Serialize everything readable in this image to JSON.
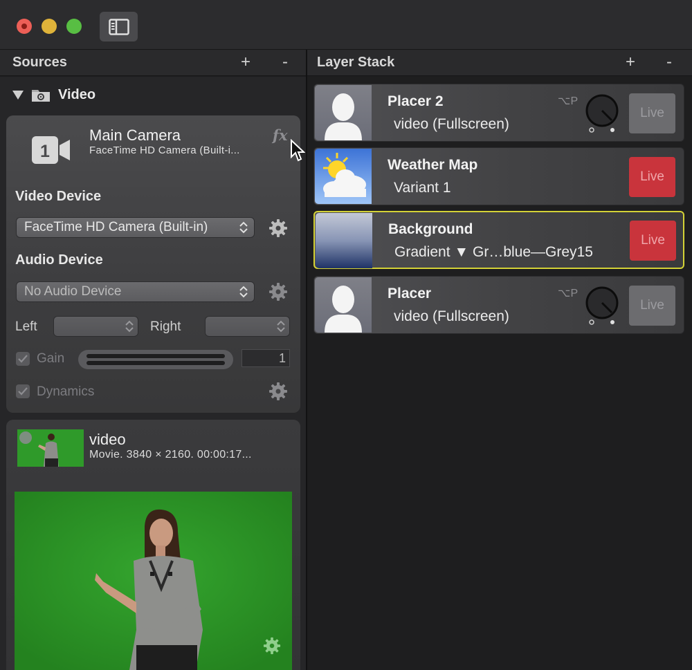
{
  "window": {
    "colors": {
      "close": "#ed5f57",
      "minimize": "#dfb33a",
      "zoom": "#58be43"
    }
  },
  "sources": {
    "title": "Sources",
    "add_label": "+",
    "remove_label": "-",
    "group": {
      "name": "Video"
    },
    "camera": {
      "title": "Main Camera",
      "subtitle": "FaceTime HD Camera (Built-i...",
      "fx_label": "fx",
      "video_device_label": "Video Device",
      "video_device_value": "FaceTime HD Camera (Built-in)",
      "audio_device_label": "Audio Device",
      "audio_device_value": "No Audio Device",
      "left_label": "Left",
      "right_label": "Right",
      "gain_label": "Gain",
      "gain_value": "1",
      "dynamics_label": "Dynamics"
    },
    "movie": {
      "title": "video",
      "subtitle": "Movie. 3840 × 2160. 00:00:17..."
    }
  },
  "layer_stack": {
    "title": "Layer Stack",
    "add_label": "+",
    "remove_label": "-",
    "layers": [
      {
        "name": "Placer 2",
        "subtitle": "video (Fullscreen)",
        "shortcut": "⌥P",
        "live_label": "Live",
        "live": false,
        "thumb": "person-silhouette-icon"
      },
      {
        "name": "Weather Map",
        "subtitle": "Variant 1",
        "shortcut": "",
        "live_label": "Live",
        "live": true,
        "thumb": "weather-icon"
      },
      {
        "name": "Background",
        "subtitle": "Gradient ▼ Gr…blue—Grey15",
        "shortcut": "",
        "live_label": "Live",
        "live": true,
        "selected": true,
        "thumb": "gradient"
      },
      {
        "name": "Placer",
        "subtitle": "video (Fullscreen)",
        "shortcut": "⌥P",
        "live_label": "Live",
        "live": false,
        "thumb": "person-silhouette-icon"
      }
    ],
    "colors": {
      "live_on": "#c9343c",
      "live_off": "#6c6c6f",
      "selection": "#d4d236"
    }
  }
}
